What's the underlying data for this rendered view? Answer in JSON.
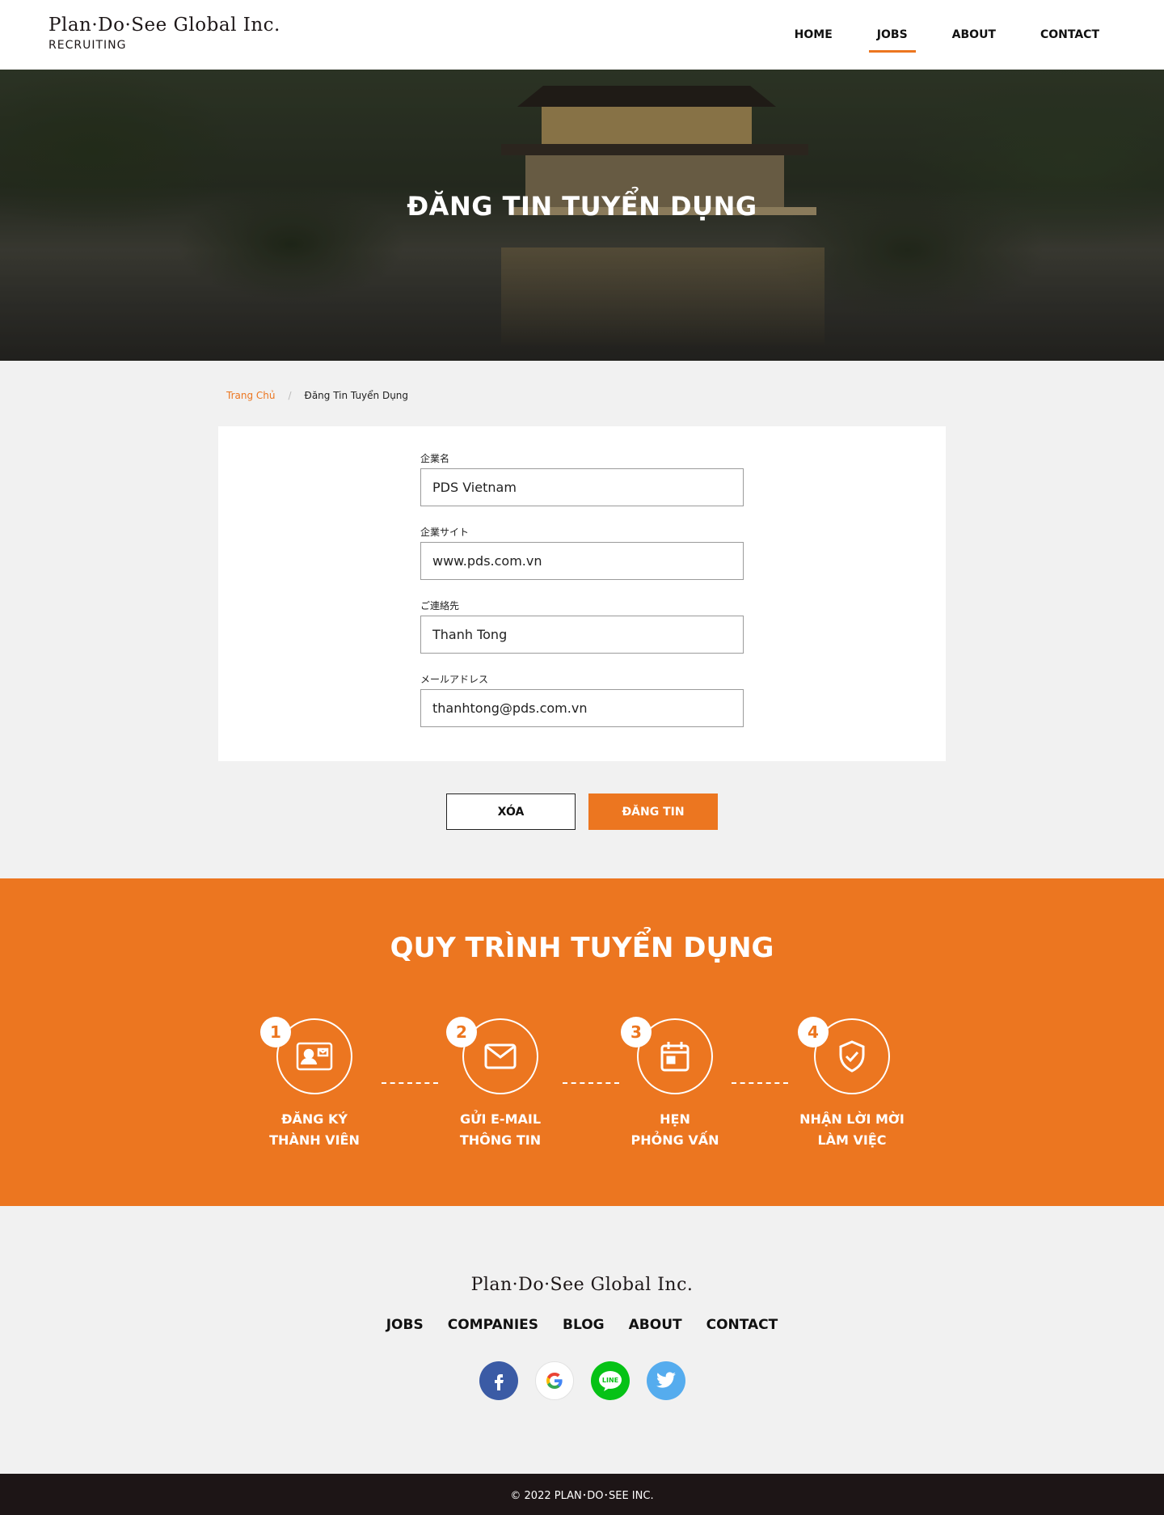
{
  "header": {
    "logo_main": "Plan·Do·See Global Inc.",
    "logo_sub": "RECRUITING",
    "nav": [
      "HOME",
      "JOBS",
      "ABOUT",
      "CONTACT"
    ],
    "active_nav": "JOBS"
  },
  "hero": {
    "title": "ĐĂNG TIN TUYỂN DỤNG"
  },
  "breadcrumb": {
    "home": "Trang Chủ",
    "separator": "/",
    "current": "Đăng Tin Tuyển Dụng"
  },
  "form": {
    "company_name": {
      "label": "企業名",
      "value": "PDS Vietnam"
    },
    "company_site": {
      "label": "企業サイト",
      "value": "www.pds.com.vn"
    },
    "contact": {
      "label": "ご連絡先",
      "value": "Thanh Tong"
    },
    "email": {
      "label": "メールアドレス",
      "value": "thanhtong@pds.com.vn"
    }
  },
  "buttons": {
    "clear": "XÓA",
    "submit": "ĐĂNG TIN"
  },
  "process": {
    "title": "QUY TRÌNH TUYỂN DỤNG",
    "steps": [
      {
        "num": "1",
        "line1": "ĐĂNG KÝ",
        "line2": "THÀNH VIÊN",
        "icon": "id-card-icon"
      },
      {
        "num": "2",
        "line1": "GỬI E-MAIL",
        "line2": "THÔNG TIN",
        "icon": "mail-icon"
      },
      {
        "num": "3",
        "line1": "HẸN",
        "line2": "PHỎNG VẤN",
        "icon": "calendar-icon"
      },
      {
        "num": "4",
        "line1": "NHẬN LỜI MỜI",
        "line2": "LÀM VIỆC",
        "icon": "shield-check-icon"
      }
    ]
  },
  "footer": {
    "logo": "Plan·Do·See Global Inc.",
    "nav": [
      "JOBS",
      "COMPANIES",
      "BLOG",
      "ABOUT",
      "CONTACT"
    ],
    "social": [
      "facebook-icon",
      "google-icon",
      "line-icon",
      "twitter-icon"
    ],
    "copyright": "© 2022 PLAN･DO･SEE INC."
  },
  "colors": {
    "accent": "#ec7620",
    "dark": "#1d1516",
    "background": "#f1f1f1"
  }
}
